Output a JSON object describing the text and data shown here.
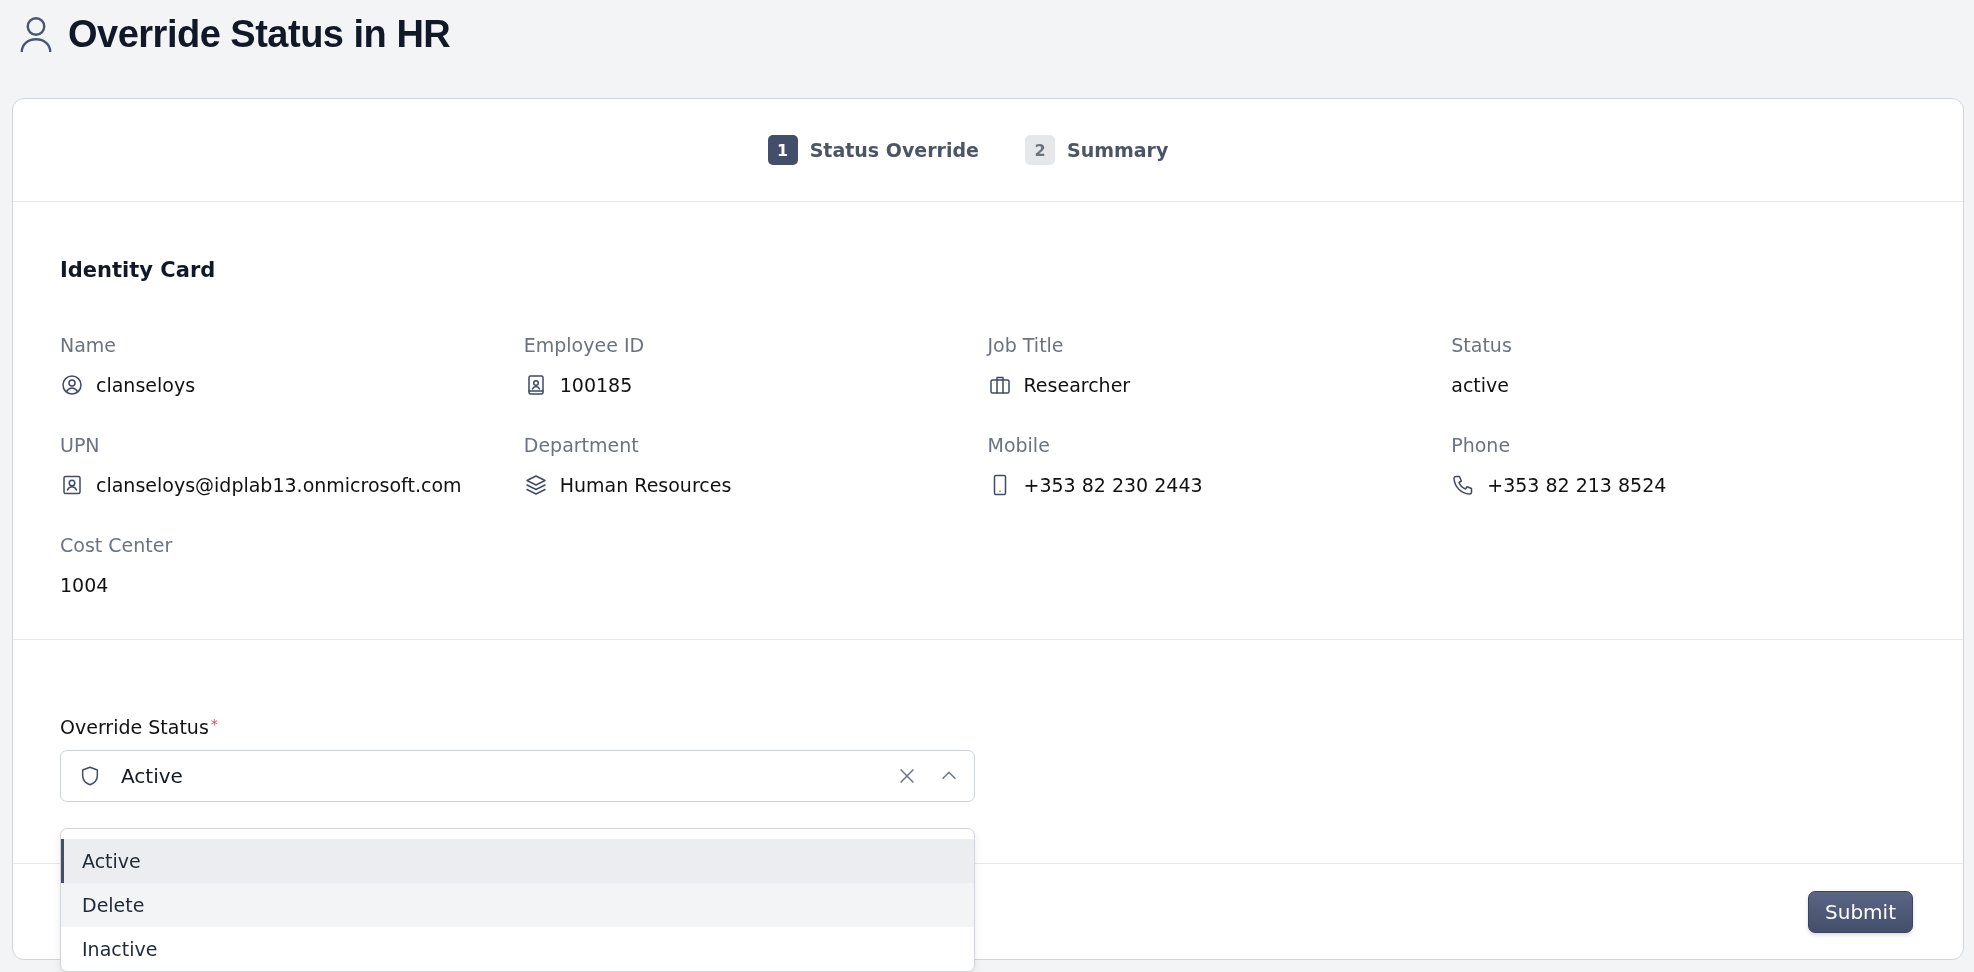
{
  "header": {
    "title": "Override Status in HR"
  },
  "steps": [
    {
      "number": "1",
      "label": "Status Override",
      "selected": true
    },
    {
      "number": "2",
      "label": "Summary",
      "selected": false
    }
  ],
  "identity_card": {
    "title": "Identity Card",
    "fields": [
      {
        "kind": "username",
        "label": "Name",
        "value": "clanseloys"
      },
      {
        "kind": "employee_id",
        "label": "Employee ID",
        "value": "100185"
      },
      {
        "kind": "job_title",
        "label": "Job Title",
        "value": "Researcher"
      },
      {
        "kind": "text",
        "label": "Status",
        "value": "active"
      },
      {
        "kind": "upn",
        "label": "UPN",
        "value": "clanseloys@idplab13.onmicrosoft.com"
      },
      {
        "kind": "department",
        "label": "Department",
        "value": "Human Resources"
      },
      {
        "kind": "mobile",
        "label": "Mobile",
        "value": "+353 82 230 2443"
      },
      {
        "kind": "phone",
        "label": "Phone",
        "value": "+353 82 213 8524"
      },
      {
        "kind": "text",
        "label": "Cost Center",
        "value": "1004"
      }
    ]
  },
  "override_status": {
    "label": "Override Status",
    "required_mark": "*",
    "value": "Active",
    "expanded": true,
    "options": [
      {
        "label": "Active",
        "selected": true,
        "hovered": false
      },
      {
        "label": "Delete",
        "selected": false,
        "hovered": true
      },
      {
        "label": "Inactive",
        "selected": false,
        "hovered": false
      }
    ]
  },
  "footer": {
    "submit": "Submit"
  }
}
